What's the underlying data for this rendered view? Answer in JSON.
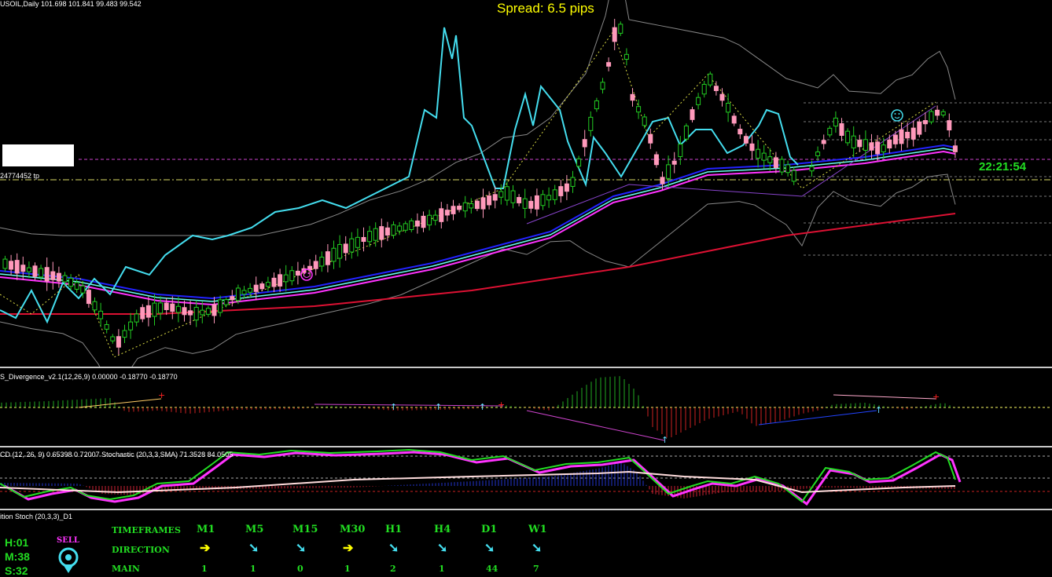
{
  "header": {
    "symbol_line": "USOIL,Daily  101.698 101.841 99.483 99.542",
    "spread": "Spread: 6.5 pips",
    "tp_label": "24774452 tp",
    "clock": "22:21:54"
  },
  "subwindows": {
    "divergence_label": "S_Divergence_v2.1(12,26,9) 0.00000 -0.18770 -0.18770",
    "stoch_label": "CD (12, 26, 9)  0.65398 0.72007  Stochastic (20,3,3,SMA) 71.3528 84.0505",
    "position_label": "ition Stoch (20,3,3)_D1"
  },
  "dashboard": {
    "hours": "H:01",
    "minutes": "M:38",
    "seconds": "S:32",
    "signal": "SELL",
    "row_labels": [
      "TIMEFRAMES",
      "DIRECTION",
      "MAIN"
    ],
    "timeframes": [
      "M1",
      "M5",
      "M15",
      "M30",
      "H1",
      "H4",
      "D1",
      "W1"
    ],
    "directions": [
      "right",
      "down-right",
      "down-right",
      "right",
      "down-right",
      "down-right",
      "down-right",
      "down-right"
    ],
    "main_values": [
      "1",
      "1",
      "0",
      "1",
      "2",
      "1",
      "44",
      "7"
    ]
  },
  "colors": {
    "background": "#000000",
    "bull_candle": "#22cc22",
    "bear_candle": "#ff99bb",
    "cyan_line": "#44ddee",
    "ma_blue": "#2222ff",
    "ma_magenta": "#ff33ff",
    "ma_red": "#dd1133",
    "band": "#888888",
    "spread_text": "#ffff00",
    "dash_green": "#22dd22",
    "dash_sell": "#ff33ff"
  },
  "chart_data": {
    "type": "candlestick",
    "symbol": "USOIL",
    "timeframe": "Daily",
    "ohlc_last": {
      "open": 101.698,
      "high": 101.841,
      "low": 99.483,
      "close": 99.542
    },
    "macd": {
      "params": [
        12,
        26,
        9
      ],
      "main": 0.65398,
      "signal": 0.72007
    },
    "stochastic": {
      "params": [
        20,
        3,
        3,
        "SMA"
      ],
      "main": 71.3528,
      "signal": 84.0505
    },
    "divergence": {
      "params": [
        12,
        26,
        9
      ],
      "values": [
        0.0,
        -0.1877,
        -0.1877
      ]
    }
  }
}
